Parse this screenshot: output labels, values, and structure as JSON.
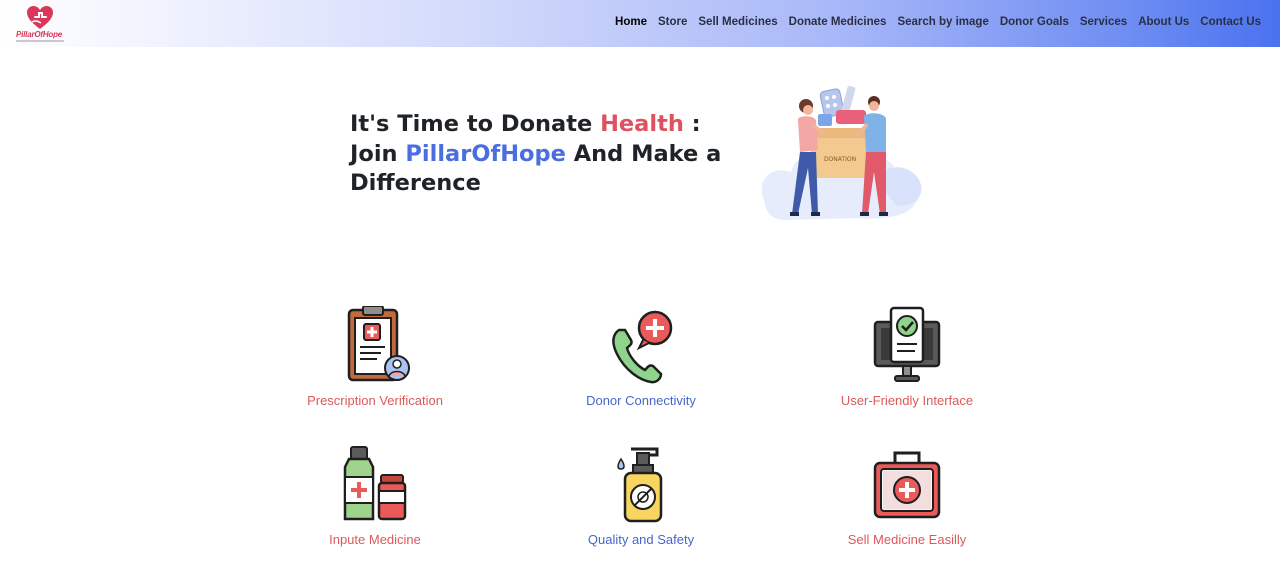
{
  "brand": {
    "name": "PillarOfHope",
    "icon": "heart-hand-icon",
    "color": "#d9385a"
  },
  "nav": {
    "items": [
      {
        "label": "Home",
        "active": true
      },
      {
        "label": "Store"
      },
      {
        "label": "Sell Medicines"
      },
      {
        "label": "Donate Medicines"
      },
      {
        "label": "Search by image"
      },
      {
        "label": "Donor Goals"
      },
      {
        "label": "Services"
      },
      {
        "label": "About Us"
      },
      {
        "label": "Contact Us"
      }
    ]
  },
  "hero": {
    "line1_pre": "It's Time to Donate ",
    "line1_highlight": "Health",
    "line1_post": " :",
    "line2_pre": "Join ",
    "line2_highlight": "PillarOfHope",
    "line2_post": " And Make a",
    "line3": "Difference",
    "illustration_box_label": "DONATION",
    "colors": {
      "red": "#e0515f",
      "blue": "#4a6ee0"
    }
  },
  "features": [
    {
      "label": "Prescription Verification",
      "icon": "prescription-clipboard-icon",
      "color": "#dc5a5a"
    },
    {
      "label": "Donor Connectivity",
      "icon": "phone-medical-icon",
      "color": "#4766c9"
    },
    {
      "label": "User-Friendly Interface",
      "icon": "monitor-check-icon",
      "color": "#dc5a5a"
    },
    {
      "label": "Inpute Medicine",
      "icon": "medicine-bottles-icon",
      "color": "#dc5a5a"
    },
    {
      "label": "Quality and Safety",
      "icon": "sanitizer-bottle-icon",
      "color": "#4766c9"
    },
    {
      "label": "Sell Medicine Easilly",
      "icon": "first-aid-kit-icon",
      "color": "#dc5a5a"
    }
  ]
}
